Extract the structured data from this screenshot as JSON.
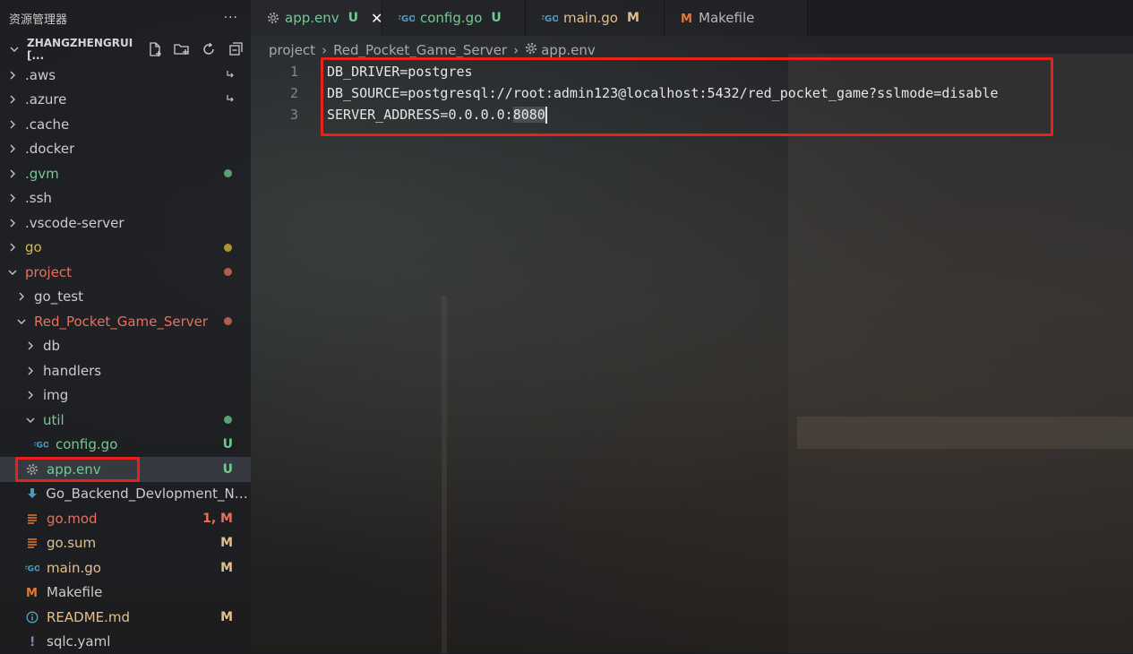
{
  "explorer": {
    "title": "资源管理器",
    "more": "···",
    "section_title": "ZHANGZHENGRUI [..."
  },
  "tree": [
    {
      "label": ".aws",
      "indent": 0,
      "expanded": false,
      "color": "white",
      "decor": "link"
    },
    {
      "label": ".azure",
      "indent": 0,
      "expanded": false,
      "color": "white",
      "decor": "link"
    },
    {
      "label": ".cache",
      "indent": 0,
      "expanded": false,
      "color": "white",
      "decor": ""
    },
    {
      "label": ".docker",
      "indent": 0,
      "expanded": false,
      "color": "white",
      "decor": ""
    },
    {
      "label": ".gvm",
      "indent": 0,
      "expanded": false,
      "color": "green",
      "decor": "dot-green"
    },
    {
      "label": ".ssh",
      "indent": 0,
      "expanded": false,
      "color": "white",
      "decor": ""
    },
    {
      "label": ".vscode-server",
      "indent": 0,
      "expanded": false,
      "color": "white",
      "decor": ""
    },
    {
      "label": "go",
      "indent": 0,
      "expanded": false,
      "color": "yellow",
      "decor": "dot-yellow"
    },
    {
      "label": "project",
      "indent": 0,
      "expanded": true,
      "color": "red",
      "decor": "dot-red"
    },
    {
      "label": "go_test",
      "indent": 1,
      "expanded": false,
      "color": "white",
      "decor": ""
    },
    {
      "label": "Red_Pocket_Game_Server",
      "indent": 1,
      "expanded": true,
      "color": "red",
      "decor": "dot-red"
    },
    {
      "label": "db",
      "indent": 2,
      "expanded": false,
      "color": "white",
      "decor": ""
    },
    {
      "label": "handlers",
      "indent": 2,
      "expanded": false,
      "color": "white",
      "decor": ""
    },
    {
      "label": "img",
      "indent": 2,
      "expanded": false,
      "color": "white",
      "decor": ""
    },
    {
      "label": "util",
      "indent": 2,
      "expanded": true,
      "color": "green",
      "decor": "dot-green"
    },
    {
      "label": "config.go",
      "indent": 3,
      "file": "go",
      "color": "green",
      "decor": "U"
    },
    {
      "label": "app.env",
      "indent": 2,
      "file": "gear",
      "color": "green",
      "decor": "U",
      "selected": true
    },
    {
      "label": "Go_Backend_Devlopment_Not...",
      "indent": 2,
      "file": "download",
      "color": "white",
      "decor": ""
    },
    {
      "label": "go.mod",
      "indent": 2,
      "file": "lines",
      "color": "red",
      "decor": "1, M"
    },
    {
      "label": "go.sum",
      "indent": 2,
      "file": "lines",
      "color": "orange",
      "decor": "M"
    },
    {
      "label": "main.go",
      "indent": 2,
      "file": "go",
      "color": "orange",
      "decor": "M"
    },
    {
      "label": "Makefile",
      "indent": 2,
      "file": "m",
      "color": "white",
      "decor": ""
    },
    {
      "label": "README.md",
      "indent": 2,
      "file": "info",
      "color": "orange",
      "decor": "M"
    },
    {
      "label": "sqlc.yaml",
      "indent": 2,
      "file": "excl",
      "color": "white",
      "decor": ""
    }
  ],
  "tabs": [
    {
      "label": "app.env",
      "icon": "gear",
      "deco": "U",
      "active": true
    },
    {
      "label": "config.go",
      "icon": "go",
      "deco": "U",
      "active": false
    },
    {
      "label": "main.go",
      "icon": "go",
      "deco": "M",
      "active": false
    },
    {
      "label": "Makefile",
      "icon": "m",
      "deco": "",
      "active": false
    }
  ],
  "breadcrumb": {
    "p1": "project",
    "p2": "Red_Pocket_Game_Server",
    "p3": "app.env"
  },
  "code": {
    "lines": [
      {
        "n": "1",
        "pre": "DB_DRIVER=postgres",
        "sel": ""
      },
      {
        "n": "2",
        "pre": "DB_SOURCE=postgresql://root:admin123@localhost:5432/red_pocket_game?sslmode=disable",
        "sel": ""
      },
      {
        "n": "3",
        "pre": "SERVER_ADDRESS=0.0.0.0:",
        "sel": "8080"
      }
    ]
  },
  "colors": {
    "green": "#73c991",
    "red": "#e8705e",
    "orange": "#e2c08d",
    "yellow": "#dcb93a",
    "highlight_box": "#e8221b",
    "go_blue": "#519aba",
    "makefile_orange": "#e37933"
  }
}
